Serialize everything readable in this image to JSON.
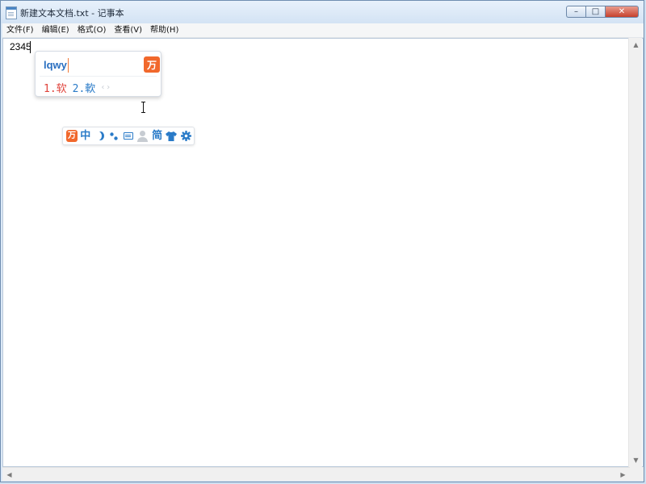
{
  "window": {
    "title": "新建文本文档.txt - 记事本",
    "controls": {
      "minimize": "–",
      "maximize": "□",
      "close": "✕"
    }
  },
  "menubar": {
    "items": [
      {
        "label": "文件(F)"
      },
      {
        "label": "编辑(E)"
      },
      {
        "label": "格式(O)"
      },
      {
        "label": "查看(V)"
      },
      {
        "label": "帮助(H)"
      }
    ]
  },
  "editor": {
    "content": "2345"
  },
  "ime": {
    "composition": "lqwy",
    "logo_glyph": "万",
    "candidates": [
      {
        "label": "1.软"
      },
      {
        "label": "2.軟"
      }
    ],
    "pager": "‹›",
    "toolbar": {
      "logo_glyph": "万",
      "mode": "中",
      "script": "简",
      "icons": [
        "wubi-logo-icon",
        "chinese-mode-icon",
        "half-width-moon-icon",
        "punctuation-icon",
        "soft-keyboard-icon",
        "user-account-icon",
        "simplified-chinese-icon",
        "skin-shirt-icon",
        "settings-gear-icon"
      ]
    }
  },
  "colors": {
    "accent_blue": "#2a7bc8",
    "ime_orange": "#f1682c",
    "first_candidate_red": "#e0433b",
    "close_red": "#c6412c"
  }
}
